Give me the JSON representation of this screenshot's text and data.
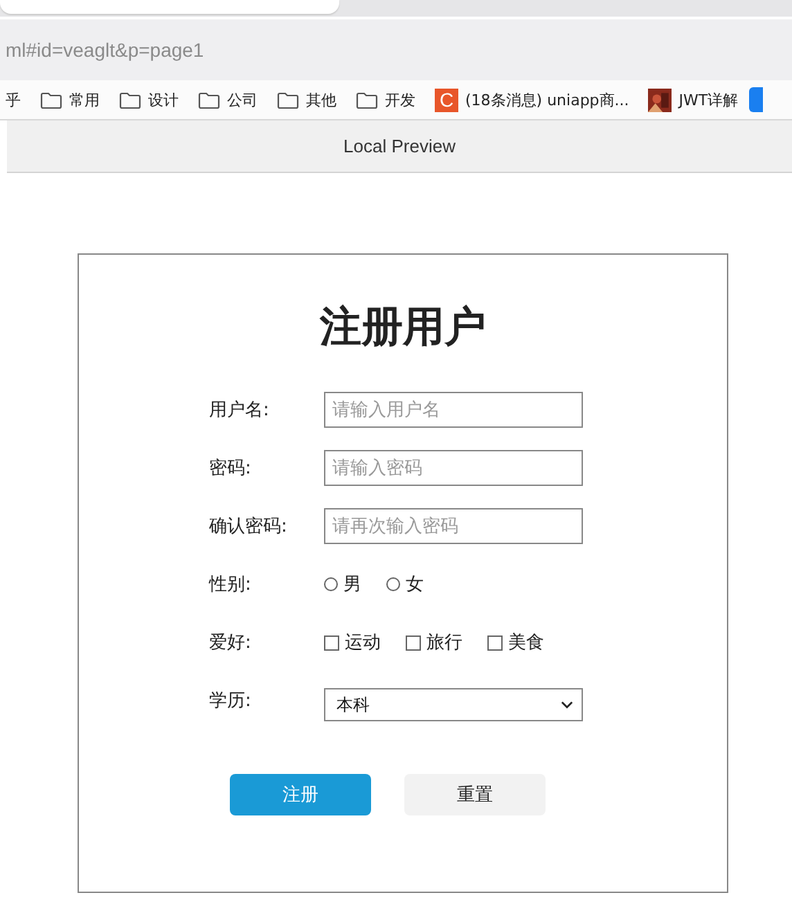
{
  "browser": {
    "address": "ml#id=veaglt&p=page1",
    "bookmarks": [
      {
        "kind": "plain",
        "label": "乎"
      },
      {
        "kind": "folder",
        "label": "常用"
      },
      {
        "kind": "folder",
        "label": "设计"
      },
      {
        "kind": "folder",
        "label": "公司"
      },
      {
        "kind": "folder",
        "label": "其他"
      },
      {
        "kind": "folder",
        "label": "开发"
      },
      {
        "kind": "letter",
        "badge": "C",
        "label": "(18条消息) uniapp商..."
      },
      {
        "label": "JWT详解"
      },
      {
        "kind": "blue"
      }
    ],
    "preview_title": "Local Preview"
  },
  "form": {
    "title": "注册用户",
    "fields": [
      {
        "kind": "text",
        "label": "用户名:",
        "placeholder": "请输入用户名"
      },
      {
        "kind": "text",
        "label": "密码:",
        "placeholder": "请输入密码"
      },
      {
        "kind": "text",
        "label": "确认密码:",
        "placeholder": "请再次输入密码"
      },
      {
        "kind": "radio",
        "label": "性别:",
        "options": [
          {
            "label": "男",
            "checked": false
          },
          {
            "label": "女",
            "checked": false
          }
        ]
      },
      {
        "kind": "checkbox",
        "label": "爱好:",
        "options": [
          {
            "label": "运动",
            "checked": false
          },
          {
            "label": "旅行",
            "checked": false
          },
          {
            "label": "美食",
            "checked": false
          }
        ]
      },
      {
        "kind": "select",
        "label": "学历:",
        "value": "本科"
      }
    ],
    "buttons": [
      {
        "kind": "primary",
        "label": "注册"
      },
      {
        "kind": "secondary",
        "label": "重置"
      }
    ]
  }
}
